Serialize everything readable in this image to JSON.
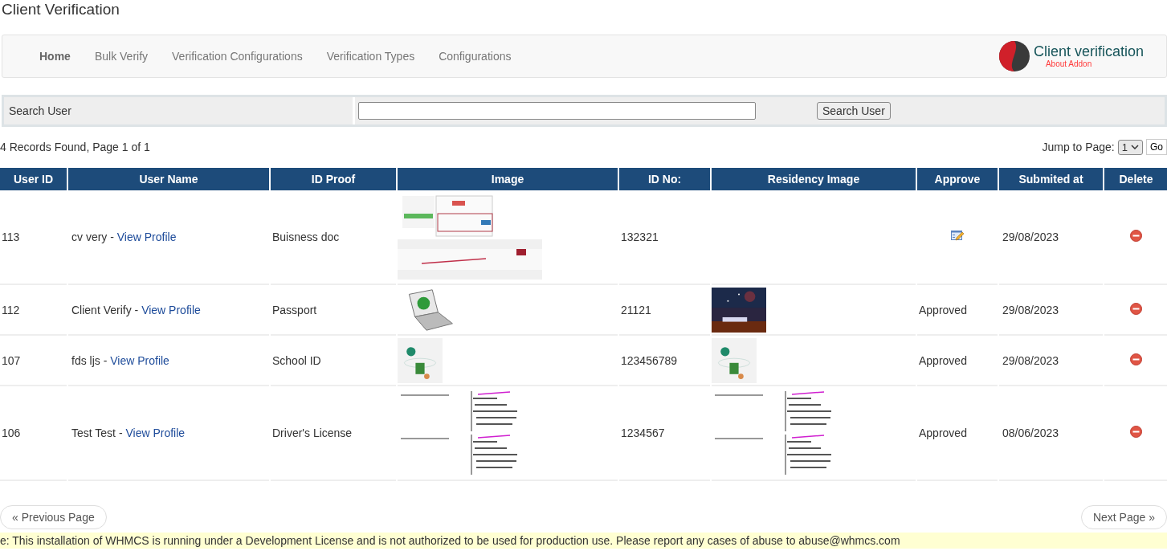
{
  "page_title": "Client Verification",
  "nav": {
    "items": [
      {
        "label": "Home",
        "selected": true
      },
      {
        "label": "Bulk Verify",
        "selected": false
      },
      {
        "label": "Verification Configurations",
        "selected": false
      },
      {
        "label": "Verification Types",
        "selected": false
      },
      {
        "label": "Configurations",
        "selected": false
      }
    ],
    "brand": {
      "title": "Client verification",
      "link": "About Addon"
    }
  },
  "search": {
    "label": "Search User",
    "button": "Search User"
  },
  "records_info": "4 Records Found, Page 1 of 1",
  "jump": {
    "label": "Jump to Page:",
    "value": "1",
    "button": "Go"
  },
  "table": {
    "columns": [
      "User ID",
      "User Name",
      "ID Proof",
      "Image",
      "ID No:",
      "Residency Image",
      "Approve",
      "Submited at",
      "Delete"
    ],
    "rows": [
      {
        "user_id": "113",
        "user_name": "cv very -",
        "profile_link": "View Profile",
        "id_proof": "Buisness doc",
        "id_no": "132321",
        "approve": {
          "kind": "icon"
        },
        "submitted": "29/08/2023"
      },
      {
        "user_id": "112",
        "user_name": "Client Verify -",
        "profile_link": "View Profile",
        "id_proof": "Passport",
        "id_no": "21121",
        "approve": {
          "kind": "text",
          "text": "Approved"
        },
        "submitted": "29/08/2023"
      },
      {
        "user_id": "107",
        "user_name": "fds ljs -",
        "profile_link": "View Profile",
        "id_proof": "School ID",
        "id_no": "123456789",
        "approve": {
          "kind": "text",
          "text": "Approved"
        },
        "submitted": "29/08/2023"
      },
      {
        "user_id": "106",
        "user_name": "Test Test -",
        "profile_link": "View Profile",
        "id_proof": "Driver's License",
        "id_no": "1234567",
        "approve": {
          "kind": "text",
          "text": "Approved"
        },
        "submitted": "08/06/2023"
      }
    ]
  },
  "pager": {
    "previous": "« Previous Page",
    "next": "Next Page »"
  },
  "license_notice": "e: This installation of WHMCS is running under a Development License and is not authorized to be used for production use. Please report any cases of abuse to abuse@whmcs.com"
}
